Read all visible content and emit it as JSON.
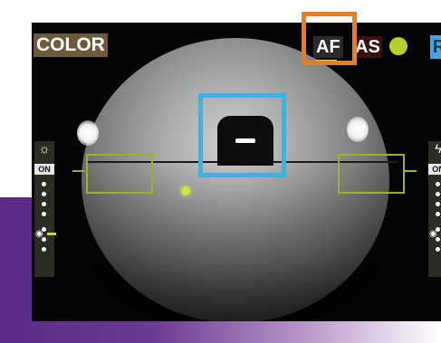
{
  "camera_view": {
    "mode_label": "COLOR",
    "af_label": "AF",
    "as_label": "AS",
    "r_label": "R",
    "status_dot_color": "#b5d22a",
    "left_panel": {
      "icon": "sun-icon",
      "on_label": "ON"
    },
    "right_panel": {
      "icon": "flash-icon",
      "on_label": "ON"
    }
  },
  "colors": {
    "highlight_orange": "#f07a1e",
    "highlight_blue": "#2fb6ea",
    "target_green": "#9fb02a",
    "focus_dot": "#cce63a"
  }
}
